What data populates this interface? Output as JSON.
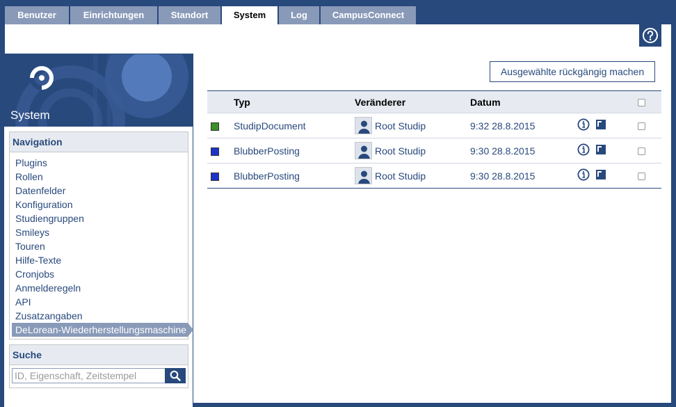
{
  "tabs": [
    {
      "label": "Benutzer",
      "active": false
    },
    {
      "label": "Einrichtungen",
      "active": false
    },
    {
      "label": "Standort",
      "active": false
    },
    {
      "label": "System",
      "active": true
    },
    {
      "label": "Log",
      "active": false
    },
    {
      "label": "CampusConnect",
      "active": false
    }
  ],
  "help": {
    "icon": "help-circle-icon"
  },
  "sidebar": {
    "title": "System",
    "navigation": {
      "heading": "Navigation",
      "items": [
        "Plugins",
        "Rollen",
        "Datenfelder",
        "Konfiguration",
        "Studiengruppen",
        "Smileys",
        "Touren",
        "Hilfe-Texte",
        "Cronjobs",
        "Anmelderegeln",
        "API",
        "Zusatzangaben",
        "DeLorean-Wiederherstellungsmaschine"
      ],
      "active_item": "DeLorean-Wiederherstellungsmaschine"
    },
    "search": {
      "heading": "Suche",
      "placeholder": "ID, Eigenschaft, Zeitstempel",
      "icon": "search-icon"
    }
  },
  "main": {
    "undo_button": "Ausgewählte rückgängig machen",
    "table": {
      "headers": {
        "typ": "Typ",
        "veraenderer": "Veränderer",
        "datum": "Datum"
      },
      "rows": [
        {
          "color": "#3a8f2a",
          "type": "StudipDocument",
          "user": "Root Studip",
          "date": "9:32 28.8.2015"
        },
        {
          "color": "#1c34c8",
          "type": "BlubberPosting",
          "user": "Root Studip",
          "date": "9:30 28.8.2015"
        },
        {
          "color": "#1c34c8",
          "type": "BlubberPosting",
          "user": "Root Studip",
          "date": "9:30 28.8.2015"
        }
      ]
    }
  },
  "colors": {
    "brand": "#28497c",
    "tab_inactive": "#899ab9",
    "widget_head": "#e7ebf1"
  }
}
